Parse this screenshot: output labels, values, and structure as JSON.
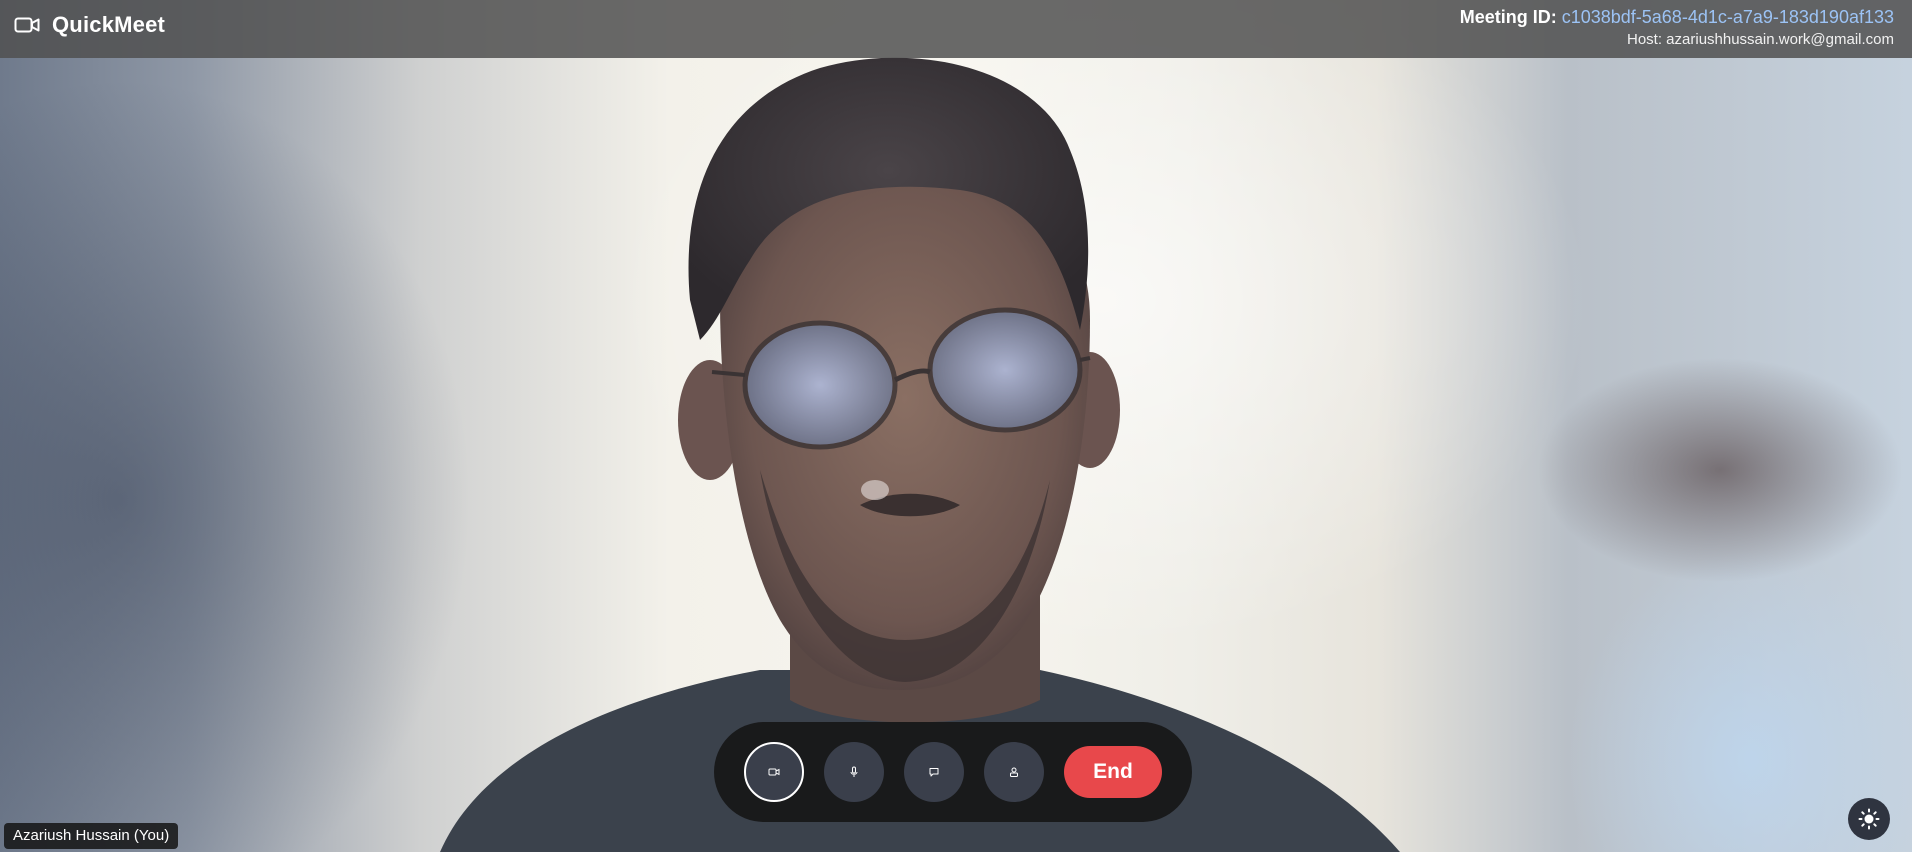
{
  "app": {
    "name": "QuickMeet",
    "logo_icon": "video-camera-icon"
  },
  "meeting": {
    "id_label": "Meeting ID:",
    "id_value": "c1038bdf-5a68-4d1c-a7a9-183d190af133",
    "host_text": "Host: azariushhussain.work@gmail.com"
  },
  "video": {
    "participant_label": "Azariush Hussain (You)"
  },
  "controls": {
    "camera_icon": "video-camera-icon",
    "camera_active": true,
    "mic_icon": "microphone-icon",
    "chat_icon": "chat-bubble-icon",
    "participants_icon": "participants-icon",
    "end_label": "End"
  },
  "theme_toggle": {
    "icon": "sun-icon"
  },
  "colors": {
    "accent_link": "#9cc3f5",
    "end_button": "#e8484b",
    "control_button": "#3a3f4b",
    "topbar": "#505050"
  }
}
